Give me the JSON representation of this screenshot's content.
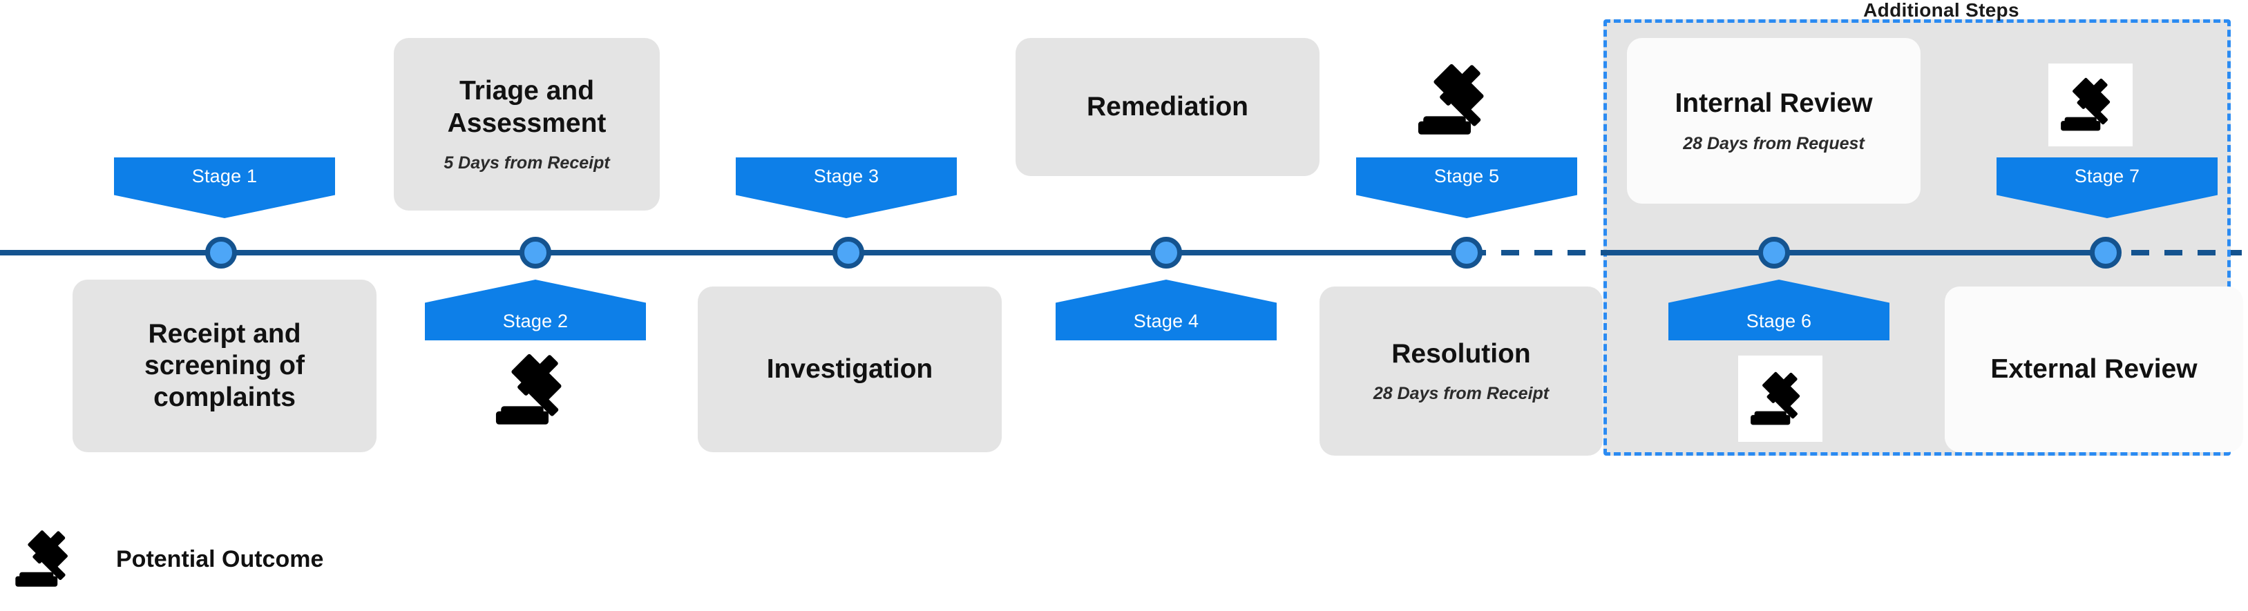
{
  "diagram": {
    "title": "Complaints handling stage timeline",
    "colors": {
      "axis": "#14538f",
      "node_fill": "#4da6f7",
      "node_ring": "#14538f",
      "badge": "#0d7fe8",
      "box_gray": "#e4e4e4",
      "box_white": "#fbfbfb",
      "region_dashed_border": "#2b8bf2",
      "region_fill": "#e4e4e4",
      "icon": "#000000"
    }
  },
  "additional_steps": {
    "label": "Additional Steps"
  },
  "stages": [
    {
      "badge": "Stage 1",
      "position": "above",
      "title": "Receipt and screening of complaints",
      "subtitle": "",
      "box_side": "below",
      "box_style": "gray",
      "outcome_icon": null
    },
    {
      "badge": "Stage 2",
      "position": "below",
      "title": "Triage and Assessment",
      "subtitle": "5 Days from Receipt",
      "box_side": "above",
      "box_style": "gray",
      "outcome_icon": "gavel-icon"
    },
    {
      "badge": "Stage 3",
      "position": "above",
      "title": "Investigation",
      "subtitle": "",
      "box_side": "below",
      "box_style": "gray",
      "outcome_icon": null
    },
    {
      "badge": "Stage 4",
      "position": "below",
      "title": "Remediation",
      "subtitle": "",
      "box_side": "above",
      "box_style": "gray",
      "outcome_icon": null
    },
    {
      "badge": "Stage 5",
      "position": "above",
      "title": "Resolution",
      "subtitle": "28 Days from Receipt",
      "box_side": "below",
      "box_style": "gray",
      "outcome_icon": "gavel-icon"
    },
    {
      "badge": "Stage 6",
      "position": "below",
      "title": "Internal Review",
      "subtitle": "28 Days from Request",
      "box_side": "above",
      "box_style": "white",
      "outcome_icon": "gavel-icon"
    },
    {
      "badge": "Stage 7",
      "position": "above",
      "title": "External Review",
      "subtitle": "",
      "box_side": "below",
      "box_style": "white",
      "outcome_icon": "gavel-icon"
    }
  ],
  "legend": {
    "icon": "gavel-icon",
    "label": "Potential Outcome"
  }
}
